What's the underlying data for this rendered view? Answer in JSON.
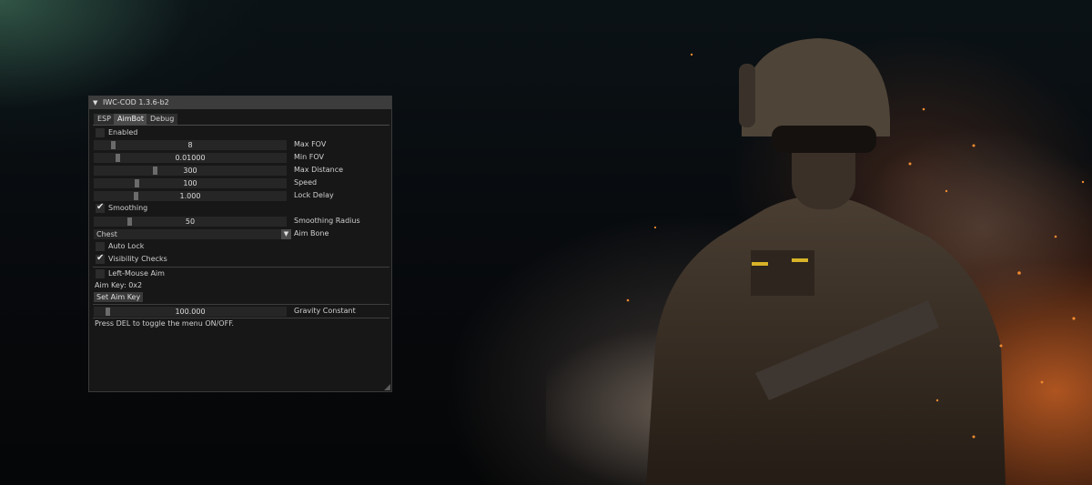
{
  "menu": {
    "title": "IWC-COD 1.3.6-b2",
    "tabs": [
      {
        "label": "ESP"
      },
      {
        "label": "AimBot"
      },
      {
        "label": "Debug"
      }
    ],
    "active_tab": "AimBot",
    "enabled": {
      "label": "Enabled",
      "checked": false
    },
    "sliders": {
      "max_fov": {
        "value": "8",
        "label": "Max FOV"
      },
      "min_fov": {
        "value": "0.01000",
        "label": "Min FOV"
      },
      "max_distance": {
        "value": "300",
        "label": "Max Distance"
      },
      "speed": {
        "value": "100",
        "label": "Speed"
      },
      "lock_delay": {
        "value": "1.000",
        "label": "Lock Delay"
      },
      "smoothing_radius": {
        "value": "50",
        "label": "Smoothing Radius"
      },
      "gravity_constant": {
        "value": "100.000",
        "label": "Gravity Constant"
      }
    },
    "smoothing": {
      "label": "Smoothing",
      "checked": true
    },
    "aim_bone": {
      "value": "Chest",
      "label": "Aim Bone"
    },
    "auto_lock": {
      "label": "Auto Lock",
      "checked": false
    },
    "visibility_checks": {
      "label": "Visibility Checks",
      "checked": true
    },
    "left_mouse_aim": {
      "label": "Left-Mouse Aim",
      "checked": false
    },
    "aim_key_text": "Aim Key: 0x2",
    "set_aim_key": "Set Aim Key",
    "footer": "Press DEL to toggle the menu ON/OFF."
  },
  "colors": {
    "window_bg": "#181818",
    "title_bg": "#3c3c3c",
    "fire": "#e46a28"
  },
  "icons": [
    "collapse-arrow-icon",
    "checkmark-icon",
    "dropdown-arrow-icon",
    "resize-grip-icon"
  ]
}
